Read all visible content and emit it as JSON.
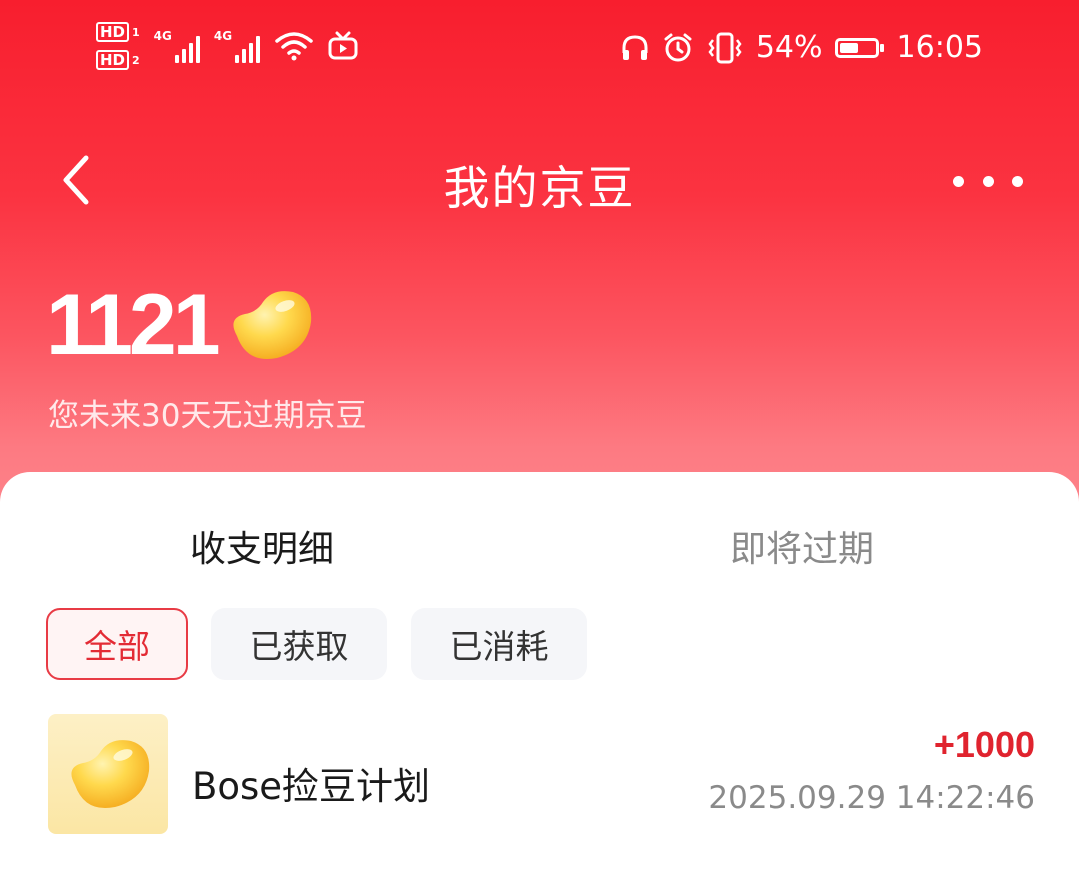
{
  "status_bar": {
    "sim_labels": [
      "HD",
      "HD"
    ],
    "sim_numbers": [
      "1",
      "2"
    ],
    "network_labels": [
      "4G",
      "4G"
    ],
    "battery_percent": "54%",
    "battery_level": 0.54,
    "time": "16:05",
    "icons": [
      "headphones-icon",
      "alarm-icon",
      "vibrate-icon",
      "wifi-icon",
      "tv-icon"
    ]
  },
  "nav": {
    "title": "我的京豆",
    "back_icon": "chevron-left-icon",
    "more_icon": "more-dots-icon"
  },
  "balance": {
    "amount": "1121",
    "note": "您未来30天无过期京豆"
  },
  "tabs": [
    {
      "label": "收支明细",
      "active": true
    },
    {
      "label": "即将过期",
      "active": false
    }
  ],
  "filters": [
    {
      "label": "全部",
      "selected": true
    },
    {
      "label": "已获取",
      "selected": false
    },
    {
      "label": "已消耗",
      "selected": false
    }
  ],
  "records": [
    {
      "title": "Bose捡豆计划",
      "amount": "+1000",
      "time": "2025.09.29 14:22:46"
    }
  ],
  "colors": {
    "header_top": "#f81e2e",
    "accent_red": "#e0232e",
    "chip_bg": "#f5f6f9"
  }
}
